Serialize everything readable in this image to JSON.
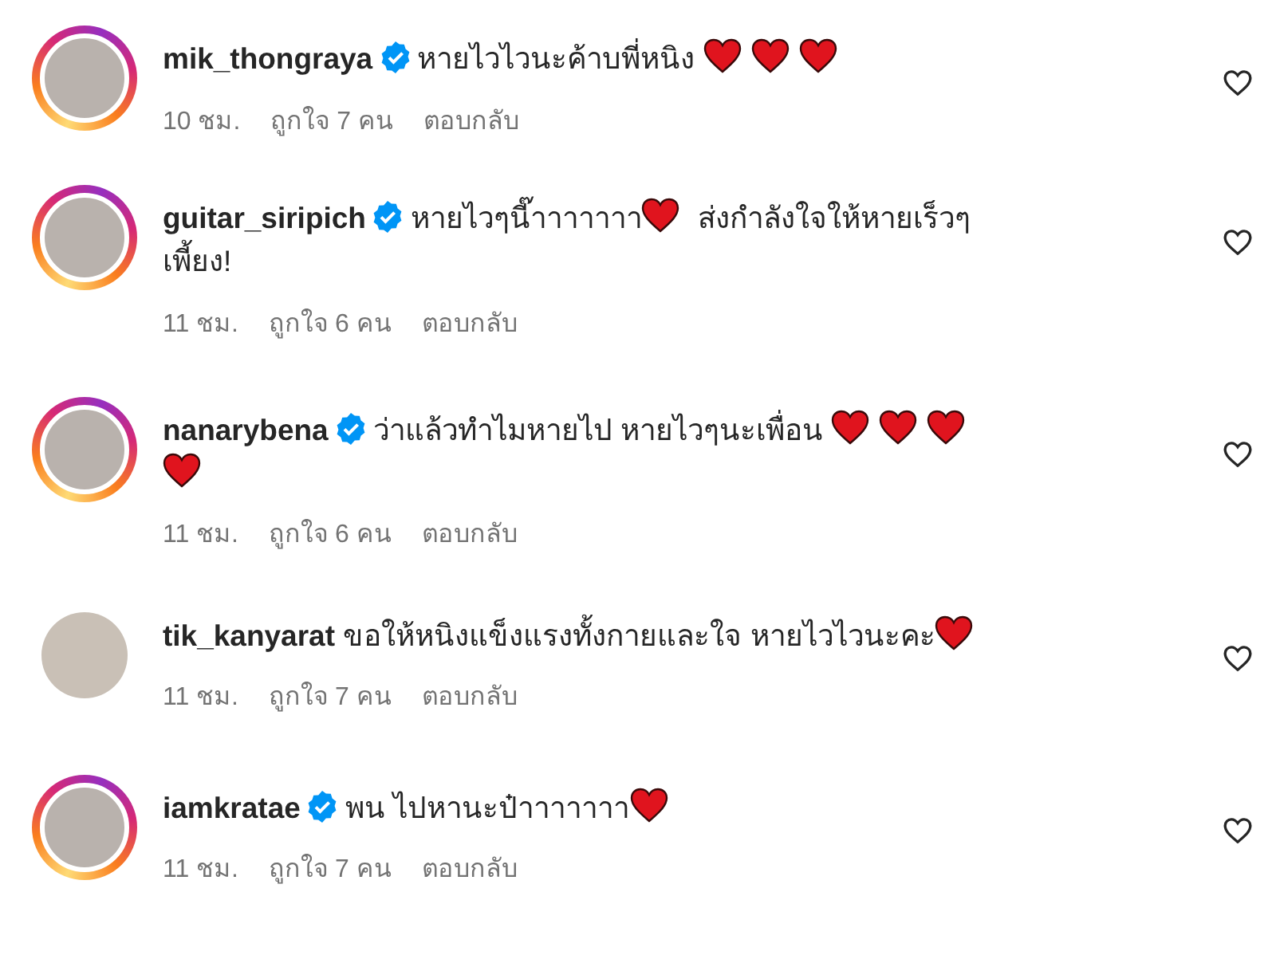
{
  "comments": [
    {
      "username": "mik_thongraya",
      "verified": true,
      "story_ring": true,
      "parts": [
        {
          "kind": "text",
          "text": "หายไวไวนะค้าบพี่หนิง "
        },
        {
          "kind": "heart"
        },
        {
          "kind": "heart"
        },
        {
          "kind": "heart"
        }
      ],
      "time": "10 ชม.",
      "likes": "ถูกใจ 7 คน",
      "reply": "ตอบกลับ"
    },
    {
      "username": "guitar_siripich",
      "verified": true,
      "story_ring": true,
      "parts": [
        {
          "kind": "text",
          "text": "หายไวๆนี๊าาาาาาา"
        },
        {
          "kind": "heart"
        },
        {
          "kind": "text",
          "text": " ส่งกำลังใจให้หายเร็วๆเพี้ยง!"
        }
      ],
      "time": "11 ชม.",
      "likes": "ถูกใจ 6 คน",
      "reply": "ตอบกลับ"
    },
    {
      "username": "nanarybena",
      "verified": true,
      "story_ring": true,
      "parts": [
        {
          "kind": "text",
          "text": "ว่าแล้วทำไมหายไป หายไวๆนะเพื่อน "
        },
        {
          "kind": "heart"
        },
        {
          "kind": "heart"
        },
        {
          "kind": "heart"
        },
        {
          "kind": "heart"
        }
      ],
      "time": "11 ชม.",
      "likes": "ถูกใจ 6 คน",
      "reply": "ตอบกลับ"
    },
    {
      "username": "tik_kanyarat",
      "verified": false,
      "story_ring": false,
      "parts": [
        {
          "kind": "text",
          "text": "ขอให้หนิงแข็งแรงทั้งกายและใจ หายไวไวนะคะ"
        },
        {
          "kind": "heart"
        }
      ],
      "time": "11 ชม.",
      "likes": "ถูกใจ 7 คน",
      "reply": "ตอบกลับ"
    },
    {
      "username": "iamkratae",
      "verified": true,
      "story_ring": true,
      "parts": [
        {
          "kind": "text",
          "text": "พน ไปหานะป๋าาาาาาา"
        },
        {
          "kind": "heart"
        }
      ],
      "time": "11 ชม.",
      "likes": "ถูกใจ 7 คน",
      "reply": "ตอบกลับ"
    }
  ]
}
